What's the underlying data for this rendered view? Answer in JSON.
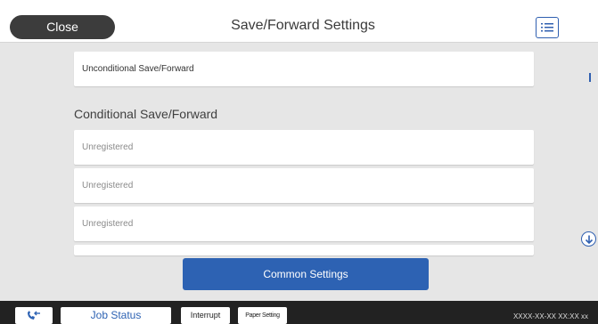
{
  "header": {
    "close_label": "Close",
    "title": "Save/Forward Settings",
    "menu_icon": "list-icon"
  },
  "main": {
    "unconditional_label": "Unconditional Save/Forward",
    "conditional_title": "Conditional Save/Forward",
    "conditional_items": [
      "Unregistered",
      "Unregistered",
      "Unregistered"
    ],
    "common_settings_label": "Common Settings"
  },
  "footer": {
    "fax_icon": "fax-phone-icon",
    "job_status_label": "Job Status",
    "interrupt_label": "Interrupt",
    "paper_setting_label": "Paper Setting",
    "datetime": "XXXX-XX-XX XX:XX xx"
  },
  "colors": {
    "accent": "#2d62b3",
    "header_bg": "#ffffff",
    "content_bg": "#e6e6e6",
    "footer_bg": "#222222",
    "close_bg": "#3c3c3c"
  }
}
